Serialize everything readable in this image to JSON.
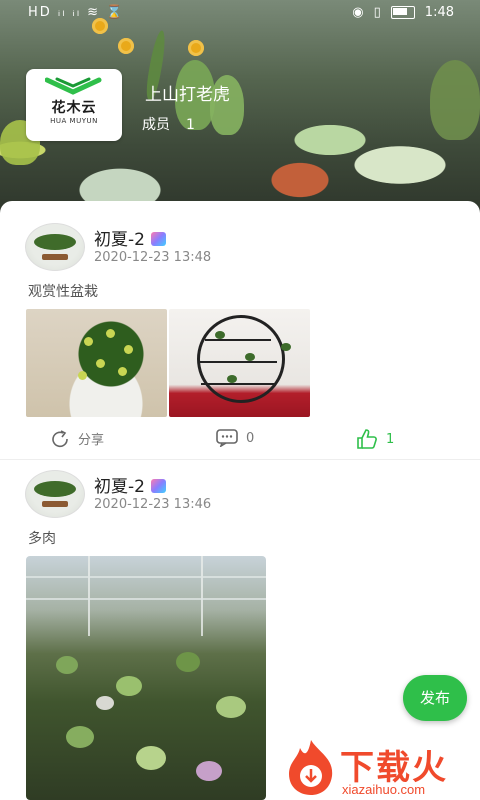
{
  "status_bar": {
    "left": "HD ᵢₗ ᵢₗ ≋ ⌛",
    "time": "1:48"
  },
  "brand": {
    "name": "花木云",
    "pinyin": "HUA MUYUN",
    "accent": "#2fbf4a"
  },
  "group": {
    "name": "上山打老虎",
    "members_label": "成员",
    "members_count": "1"
  },
  "posts": [
    {
      "username": "初夏-2",
      "time": "2020-12-23 13:48",
      "text": "观赏性盆栽",
      "share_label": "分享",
      "comment_count": "0",
      "like_count": "1"
    },
    {
      "username": "初夏-2",
      "time": "2020-12-23 13:46",
      "text": "多肉"
    }
  ],
  "fab_label": "发布",
  "watermark": {
    "text": "下载火",
    "url": "xiazaihuo.com"
  }
}
